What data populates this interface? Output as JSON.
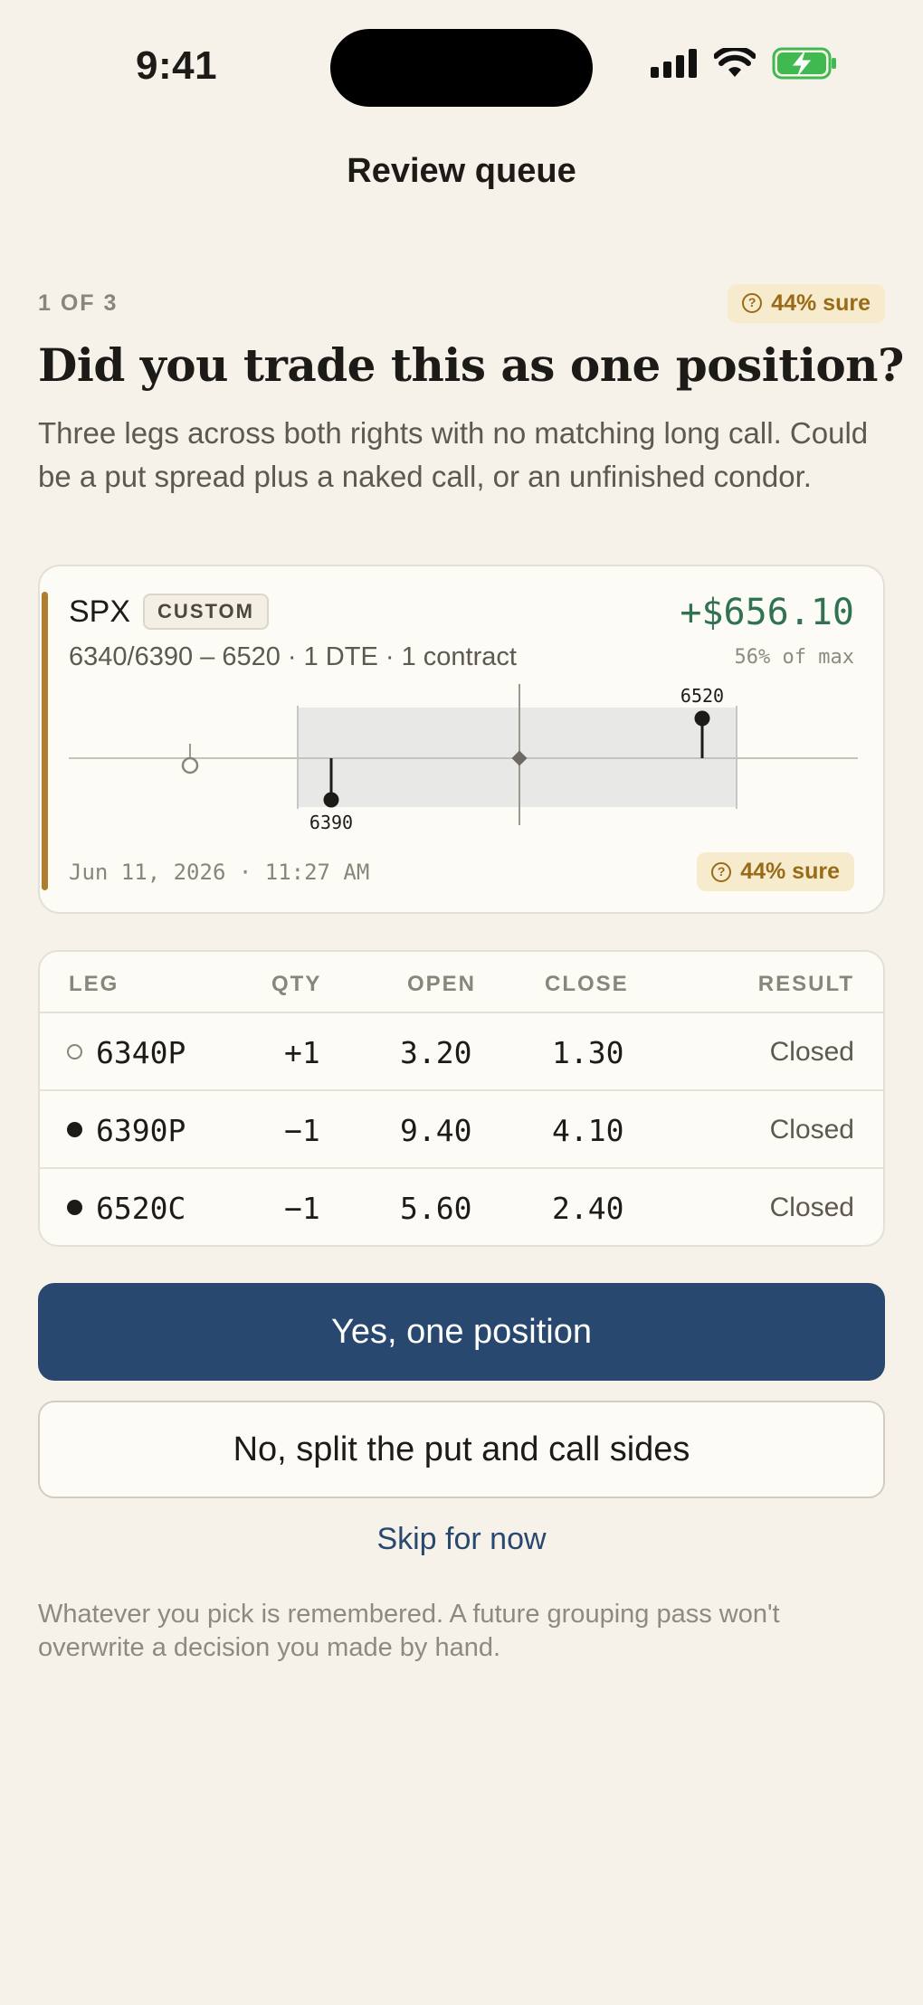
{
  "status": {
    "time": "9:41"
  },
  "nav": {
    "title": "Review queue"
  },
  "header": {
    "step": "1 OF 3",
    "confidence": "44% sure",
    "question": "Did you trade this as one position?",
    "explanation": "Three legs across both rights with no matching long call. Could be a put spread plus a naked call, or an unfinished condor."
  },
  "card": {
    "symbol": "SPX",
    "tag": "CUSTOM",
    "strikes": "6340/6390 – 6520",
    "dte": "1 DTE",
    "contracts": "1 contract",
    "pnl": "+$656.10",
    "pct_of_max": "56% of max",
    "strike_labels": {
      "short_put": "6390",
      "short_call": "6520"
    },
    "timestamp": "Jun 11, 2026 · 11:27 AM",
    "confidence": "44% sure"
  },
  "table": {
    "headers": {
      "leg": "LEG",
      "qty": "QTY",
      "open": "OPEN",
      "close": "CLOSE",
      "result": "RESULT"
    },
    "rows": [
      {
        "leg": "6340P",
        "qty": "+1",
        "open": "3.20",
        "close": "1.30",
        "result": "Closed"
      },
      {
        "leg": "6390P",
        "qty": "−1",
        "open": "9.40",
        "close": "4.10",
        "result": "Closed"
      },
      {
        "leg": "6520C",
        "qty": "−1",
        "open": "5.60",
        "close": "2.40",
        "result": "Closed"
      }
    ]
  },
  "actions": {
    "primary": "Yes, one position",
    "secondary": "No, split the put and call sides",
    "skip": "Skip for now"
  },
  "footnote": "Whatever you pick is remembered. A future grouping pass won't overwrite a decision you made by hand.",
  "colors": {
    "accent": "#284870",
    "profit": "#2f7254",
    "confidence": "#9a6b16",
    "card_bar": "#b07d2e"
  }
}
